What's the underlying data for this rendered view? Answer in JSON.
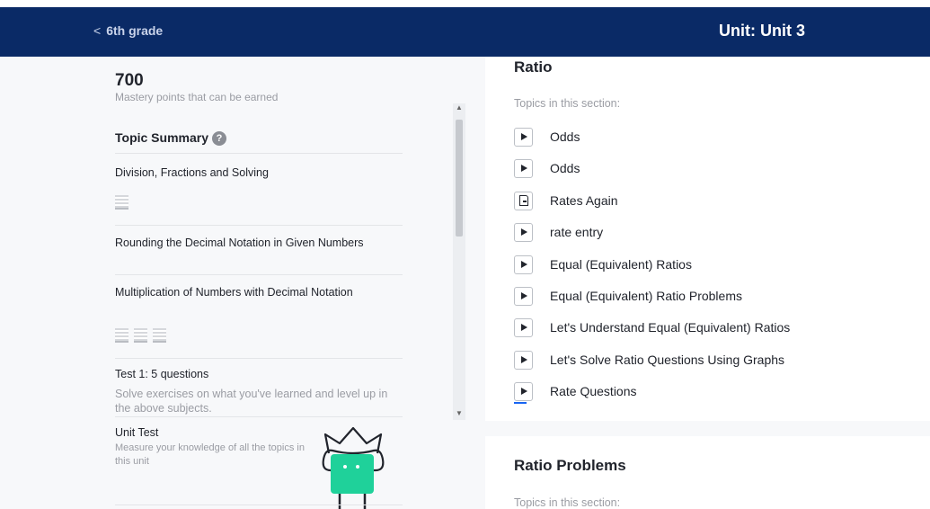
{
  "header": {
    "back_label": "6th grade",
    "unit_title": "Unit: Unit 3"
  },
  "left_panel": {
    "mastery_points": "700",
    "mastery_desc": "Mastery points that can be earned",
    "summary_title": "Topic Summary",
    "topics": [
      {
        "title": "Division, Fractions and Solving",
        "skills": 1
      },
      {
        "title": "Rounding the Decimal Notation in Given Numbers",
        "skills": 0
      },
      {
        "title": "Multiplication of Numbers with Decimal Notation",
        "skills": 3
      }
    ],
    "test": {
      "title": "Test 1: 5 questions",
      "desc": "Solve exercises on what you've learned and level up in the above subjects."
    },
    "unit_test": {
      "title": "Unit Test",
      "desc": "Measure your knowledge of all the topics in this unit"
    }
  },
  "sections": [
    {
      "title": "Ratio",
      "subtitle": "Topics in this section:",
      "items": [
        {
          "label": "Odds",
          "icon": "play-icon"
        },
        {
          "label": "Odds",
          "icon": "play-icon"
        },
        {
          "label": "Rates Again",
          "icon": "article-icon"
        },
        {
          "label": "rate entry",
          "icon": "play-icon"
        },
        {
          "label": "Equal (Equivalent) Ratios",
          "icon": "play-icon"
        },
        {
          "label": "Equal (Equivalent) Ratio Problems",
          "icon": "play-icon"
        },
        {
          "label": "Let's Understand Equal (Equivalent) Ratios",
          "icon": "play-icon"
        },
        {
          "label": "Let's Solve Ratio Questions Using Graphs",
          "icon": "play-icon"
        },
        {
          "label": "Rate Questions",
          "icon": "play-icon",
          "progress_started": true
        }
      ]
    },
    {
      "title": "Ratio Problems",
      "subtitle": "Topics in this section:"
    }
  ],
  "colors": {
    "header_bg": "#0a2a66",
    "progress_accent": "#1865f2",
    "mascot_green": "#1fd19a"
  }
}
